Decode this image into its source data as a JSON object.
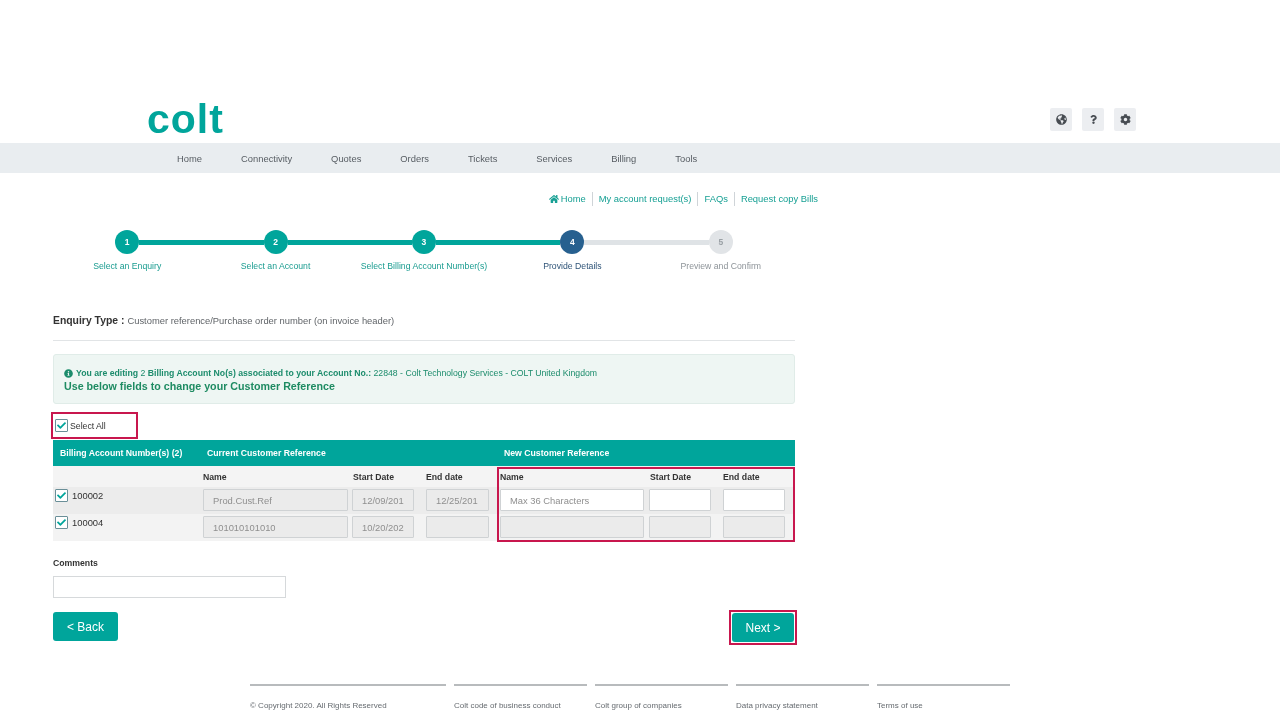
{
  "header": {
    "logo": "colt"
  },
  "nav": {
    "items": [
      "Home",
      "Connectivity",
      "Quotes",
      "Orders",
      "Tickets",
      "Services",
      "Billing",
      "Tools"
    ]
  },
  "quick_links": [
    "Home",
    "My account request(s)",
    "FAQs",
    "Request copy Bills"
  ],
  "stepper": {
    "steps": [
      {
        "number": "1",
        "label": "Select an Enquiry",
        "selected": false
      },
      {
        "number": "2",
        "label": "Select an Account",
        "selected": false
      },
      {
        "number": "3",
        "label": "Select Billing Account Number(s)",
        "selected": false
      },
      {
        "number": "4",
        "label": "Provide Details",
        "selected": true
      },
      {
        "number": "5",
        "label": "Preview and Confirm",
        "selected": false
      }
    ]
  },
  "enquiry_type": {
    "label": "Enquiry Type :",
    "value": "Customer reference/Purchase order number (on invoice header)"
  },
  "info_box": {
    "message": "**You are editing** 2 **Billing Account No(s) associated to your Account No.:** 22848 - Colt Technology Services - COLT United Kingdom",
    "heading": "Use below fields to change your Customer Reference"
  },
  "select_all": {
    "label": "Select All",
    "checked": true,
    "highlighted": true
  },
  "table": {
    "group_headers": [
      "Billing Account Number(s) (2)",
      "Current Customer Reference",
      "New Customer Reference"
    ],
    "columns": [
      "Name",
      "Start Date",
      "End date",
      "Name",
      "Start Date",
      "End date"
    ],
    "new_reference_highlighted": true,
    "rows": [
      {
        "account": "100002",
        "checked": true,
        "current_name": "Prod.Cust.Ref",
        "current_start_date": "12/09/201",
        "current_end_date": "12/25/201",
        "new_name_placeholder": "Max 36 Characters",
        "new_disabled": false
      },
      {
        "account": "100004",
        "checked": true,
        "current_name": "101010101010",
        "current_start_date": "10/20/202",
        "new_disabled": true
      }
    ]
  },
  "comments": {
    "label": "Comments"
  },
  "back_button": {
    "label": "< Back"
  },
  "next_button": {
    "label": "Next >",
    "highlighted": true
  },
  "footer": {
    "items": [
      "© Copyright 2020. All Rights Reserved",
      "Colt code of business conduct",
      "Colt group of companies",
      "Data privacy statement",
      "Terms of use"
    ]
  }
}
